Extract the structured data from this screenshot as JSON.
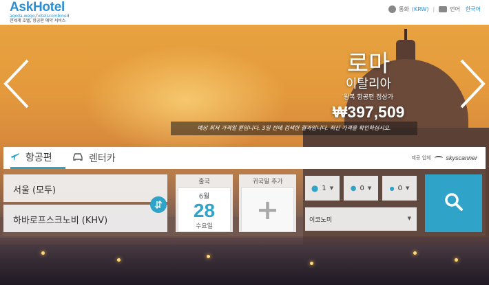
{
  "header": {
    "logo_title": "AskHotel",
    "logo_sub1": "agoda,wego,hotelscombined",
    "logo_sub2": "전세계 호텔, 항공편 예약 서비스",
    "currency_label": "통화",
    "currency_value": "(KRW)",
    "separator": "|",
    "language_label": "언어",
    "language_value": "한국어"
  },
  "hero": {
    "city": "로마",
    "country": "이탈리아",
    "note": "왕복 항공편 정상가",
    "price": "₩397,509",
    "notice": "예상 최저 가격일 뿐입니다. 3일 전에 검색한 결과입니다. 최신 가격을 확인하십시오."
  },
  "search": {
    "tabs": [
      {
        "label": "항공편",
        "icon": "airplane-icon",
        "active": true
      },
      {
        "label": "렌터카",
        "icon": "car-icon",
        "active": false
      }
    ],
    "powered_by_label": "제공 업체",
    "powered_by_brand": "skyscanner",
    "from": "서울 (모두)",
    "to": "하바로프스크노비 (KHV)",
    "depart_label": "출국",
    "depart_month": "6월",
    "depart_day": "28",
    "depart_weekday": "수요일",
    "return_label": "귀국일 추가",
    "return_symbol": "+",
    "passengers": [
      {
        "type": "adult",
        "count": "1"
      },
      {
        "type": "child",
        "count": "0"
      },
      {
        "type": "infant",
        "count": "0"
      }
    ],
    "cabin_class": "이코노미"
  },
  "colors": {
    "accent": "#2fa3c8",
    "brand": "#2d8fd0"
  }
}
